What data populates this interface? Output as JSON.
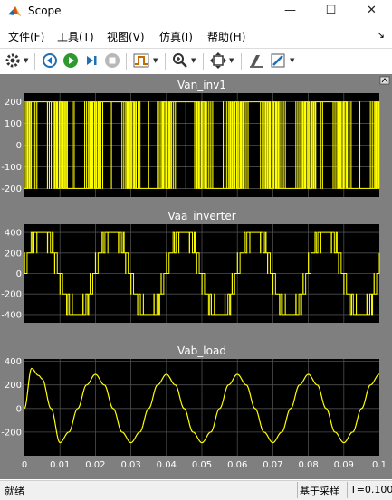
{
  "window": {
    "title": "Scope",
    "controls": [
      "—",
      "☐",
      "✕"
    ]
  },
  "menu": {
    "items": [
      {
        "label": "文件(F)"
      },
      {
        "label": "工具(T)"
      },
      {
        "label": "视图(V)"
      },
      {
        "label": "仿真(I)"
      },
      {
        "label": "帮助(H)"
      }
    ],
    "dock_arrow": "↘"
  },
  "toolbar": {
    "buttons": [
      "gear-icon",
      "tool-dropdown-icon",
      "rewind-icon",
      "run-icon",
      "step-forward-icon",
      "stop-icon",
      "trigger-icon",
      "zoom-icon",
      "fit-icon",
      "style-icon",
      "measure-icon"
    ]
  },
  "colors": {
    "plot_bg": "#000000",
    "trace": "#ffff00",
    "frame": "#7f7f7f",
    "grid": "#4d4d4d"
  },
  "chart_data": [
    {
      "type": "line",
      "title": "Van_inv1",
      "xlim": [
        0,
        0.1
      ],
      "ylim": [
        -240,
        240
      ],
      "yticks": [
        200,
        100,
        0,
        -100,
        -200
      ],
      "series": [
        {
          "values_description_free": true,
          "kind": "pwm_two_level",
          "fundamental_hz": 50,
          "carrier_hz": 1000,
          "levels": [
            200,
            -200
          ],
          "x_range": [
            0,
            0.1
          ]
        }
      ]
    },
    {
      "type": "line",
      "title": "Vaa_inverter",
      "xlim": [
        0,
        0.1
      ],
      "ylim": [
        -480,
        480
      ],
      "yticks": [
        400,
        200,
        0,
        -200,
        -400
      ],
      "series": [
        {
          "kind": "pwm_multilevel",
          "fundamental_hz": 50,
          "carrier_hz": 1000,
          "levels": [
            400,
            200,
            0,
            -200,
            -400
          ],
          "x_range": [
            0,
            0.1
          ]
        }
      ]
    },
    {
      "type": "line",
      "title": "Vab_load",
      "xlim": [
        0,
        0.1
      ],
      "ylim": [
        -400,
        420
      ],
      "yticks": [
        400,
        200,
        0,
        -200
      ],
      "xticks": [
        "0",
        "0.01",
        "0.02",
        "0.03",
        "0.04",
        "0.05",
        "0.06",
        "0.07",
        "0.08",
        "0.09",
        "0.1"
      ],
      "series": [
        {
          "kind": "sine",
          "fundamental_hz": 50,
          "x": [
            0,
            0.002,
            0.004,
            0.005,
            0.0075,
            0.01,
            0.0125,
            0.015,
            0.0175,
            0.02,
            0.0225,
            0.025,
            0.0275,
            0.03,
            0.0325,
            0.035,
            0.0375,
            0.04,
            0.0425,
            0.045,
            0.0475,
            0.05,
            0.0525,
            0.055,
            0.0575,
            0.06,
            0.0625,
            0.065,
            0.0675,
            0.07,
            0.0725,
            0.075,
            0.0775,
            0.08,
            0.0825,
            0.085,
            0.0875,
            0.09,
            0.0925,
            0.095,
            0.0975,
            0.1
          ],
          "y": [
            0,
            340,
            280,
            250,
            0,
            -290,
            -200,
            0,
            200,
            290,
            200,
            0,
            -200,
            -290,
            -200,
            0,
            200,
            290,
            200,
            0,
            -200,
            -290,
            -200,
            0,
            200,
            290,
            200,
            0,
            -200,
            -290,
            -200,
            0,
            200,
            290,
            200,
            0,
            -200,
            -290,
            -200,
            0,
            200,
            290
          ]
        }
      ]
    }
  ],
  "status": {
    "text": "就绪",
    "mode": "基于采样",
    "time": "T=0.100"
  }
}
